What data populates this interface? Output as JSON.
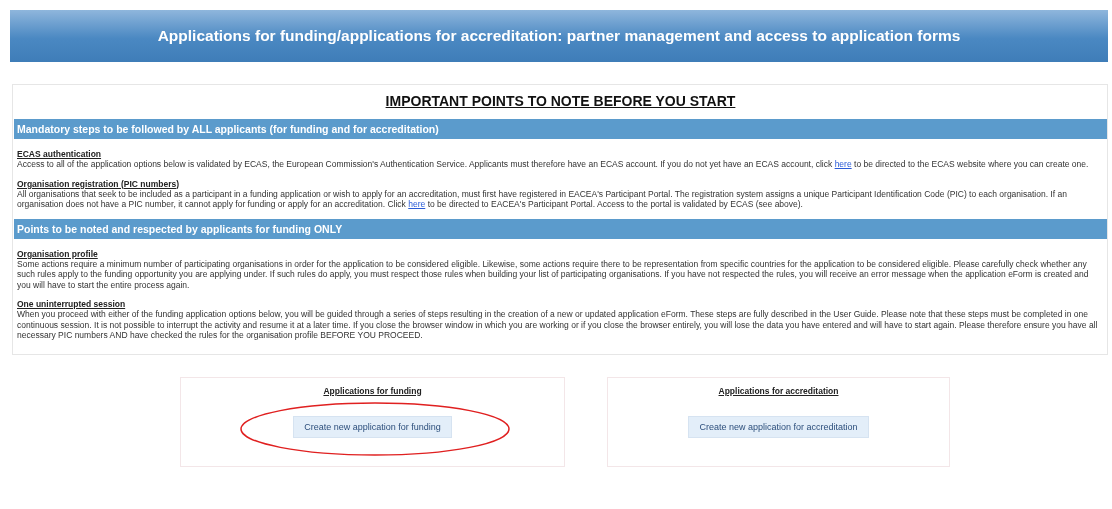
{
  "banner": {
    "title": "Applications for funding/applications for accreditation: partner management and access to application forms"
  },
  "notice": {
    "title": "IMPORTANT POINTS TO NOTE BEFORE YOU START",
    "sections": [
      {
        "heading": "Mandatory steps to be followed by ALL applicants (for funding and for accreditation)",
        "items": [
          {
            "title": "ECAS authentication",
            "text_before": "Access to all of the application options below is validated by ECAS, the European Commission's Authentication Service. Applicants must therefore have an ECAS account. If you do not yet have an ECAS account, click",
            "link": "here",
            "text_after": "to be directed to the ECAS website where you can create one."
          },
          {
            "title": "Organisation registration (PIC numbers)",
            "text_before": "All organisations that seek to be included as a participant in a funding application or wish to apply for an accreditation, must first have registered in EACEA's Participant Portal. The registration system assigns a unique Participant Identification Code (PIC) to each organisation. If an organisation does not have a PIC number, it cannot apply for funding or apply for an accreditation. Click",
            "link": "here",
            "text_after": "to be directed to EACEA's Participant Portal. Access to the portal is validated by ECAS (see above)."
          }
        ]
      },
      {
        "heading": "Points to be noted and respected by applicants for funding ONLY",
        "items": [
          {
            "title": "Organisation profile",
            "text_before": "Some actions require a minimum number of participating organisations in order for the application to be considered eligible. Likewise, some actions require there to be representation from specific countries for the application to be considered eligible. Please carefully check whether any such rules apply to the funding opportunity you are applying under. If such rules do apply, you must respect those rules when building your list of participating organisations. If you have not respected the rules, you will receive an error message when the application eForm is created and you will have to start the entire process again."
          },
          {
            "title": "One uninterrupted session",
            "text_before": "When you proceed with either of the funding application options below, you will be guided through a series of steps resulting in the creation of a new or updated application eForm. These steps are fully described in the User Guide. Please note that these steps must be completed in one continuous session. It is not possible to interrupt the activity and resume it at a later time. If you close the browser window in which you are working or if you close the browser entirely, you will lose the data you have entered and will have to start again. Please therefore ensure you have all necessary PIC numbers AND have checked the rules for the organisation profile BEFORE YOU PROCEED."
          }
        ]
      }
    ]
  },
  "cards": [
    {
      "title": "Applications for funding",
      "button": "Create new application for funding",
      "circled": true
    },
    {
      "title": "Applications for accreditation",
      "button": "Create new application for accreditation",
      "circled": false
    }
  ]
}
